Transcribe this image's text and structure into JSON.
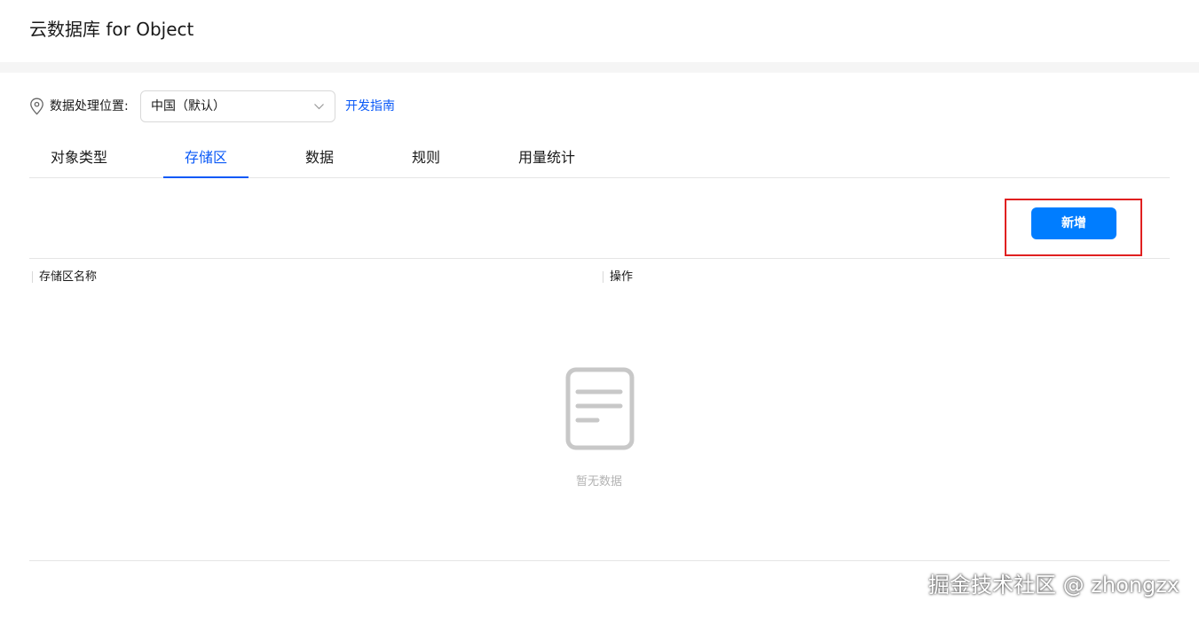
{
  "header": {
    "title": "云数据库 for Object"
  },
  "location": {
    "label": "数据处理位置:",
    "selected_region": "中国（默认）",
    "dev_guide_link": "开发指南",
    "pin_icon": "location-pin-icon",
    "chevron_icon": "chevron-down-icon"
  },
  "tabs": [
    {
      "label": "对象类型",
      "active": false
    },
    {
      "label": "存储区",
      "active": true
    },
    {
      "label": "数据",
      "active": false
    },
    {
      "label": "规则",
      "active": false
    },
    {
      "label": "用量统计",
      "active": false
    }
  ],
  "toolbar": {
    "add_label": "新增"
  },
  "table": {
    "columns": [
      "存储区名称",
      "操作"
    ],
    "rows": [],
    "empty_text": "暂无数据",
    "empty_icon": "empty-document-icon"
  },
  "watermark": "掘金技术社区 @ zhongzx",
  "colors": {
    "accent": "#0a59f7",
    "button_bg": "#007dff",
    "highlight": "#e02020"
  }
}
